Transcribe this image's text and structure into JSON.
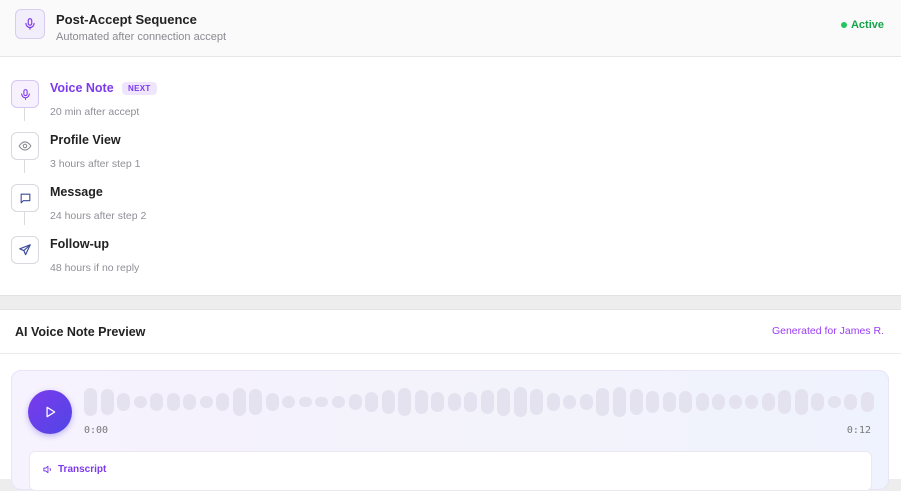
{
  "header": {
    "title": "Post-Accept Sequence",
    "subtitle": "Automated after connection accept",
    "status": "Active",
    "icon": "microphone-icon"
  },
  "steps": [
    {
      "title": "Voice Note",
      "badge": "NEXT",
      "timing": "20 min after accept",
      "icon": "microphone-icon"
    },
    {
      "title": "Profile View",
      "timing": "3 hours after step 1",
      "icon": "eye-icon"
    },
    {
      "title": "Message",
      "timing": "24 hours after step 2",
      "icon": "message-icon"
    },
    {
      "title": "Follow-up",
      "timing": "48 hours if no reply",
      "icon": "send-icon"
    }
  ],
  "preview": {
    "title": "AI Voice Note Preview",
    "generated_for": "Generated for James R.",
    "time_start": "0:00",
    "time_end": "0:12",
    "transcript_label": "Transcript"
  },
  "colors": {
    "accent": "#7c3aed",
    "active": "#16a34a"
  }
}
